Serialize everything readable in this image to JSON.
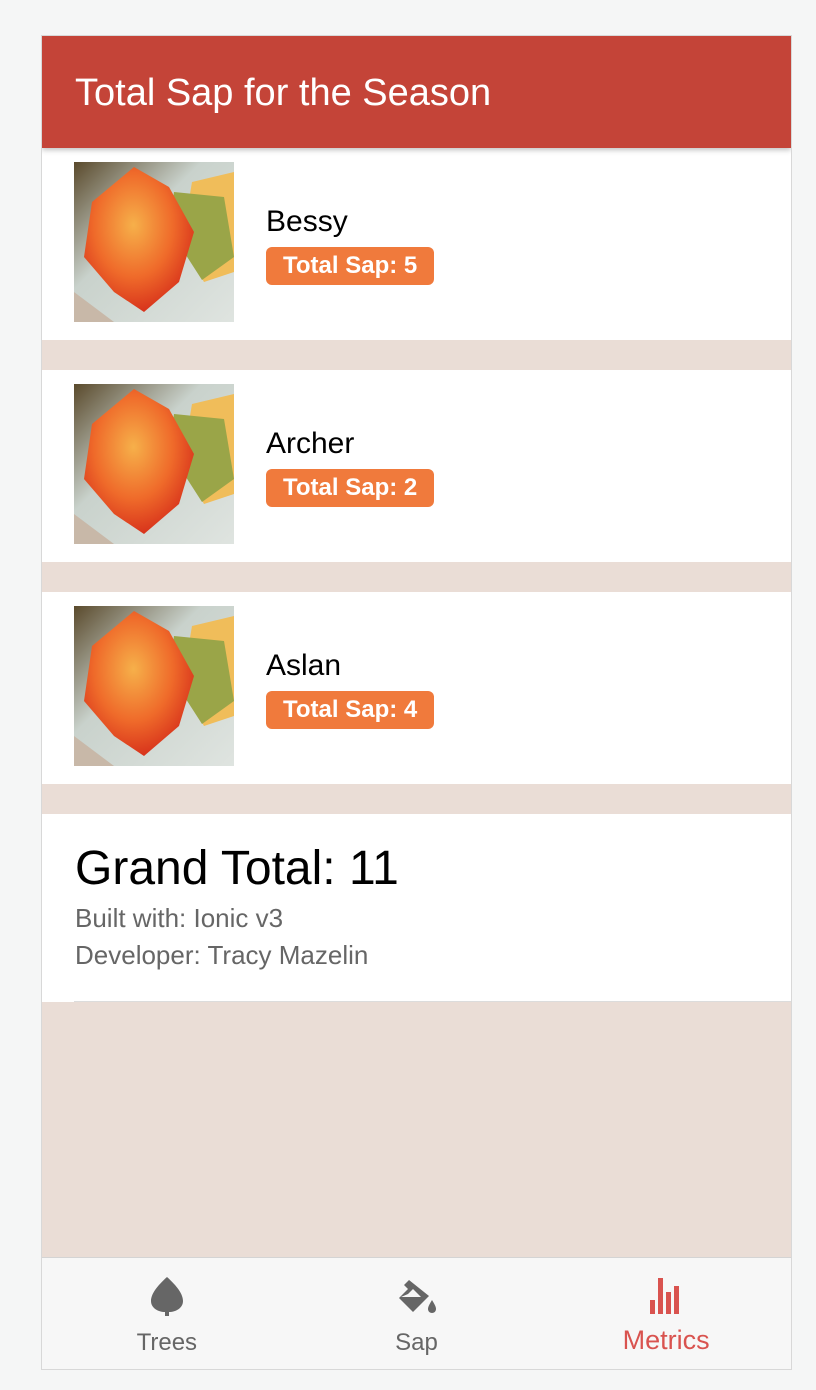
{
  "header": {
    "title": "Total Sap for the Season"
  },
  "trees": [
    {
      "name": "Bessy",
      "badge": "Total Sap: 5",
      "image": "maple-leaf-photo"
    },
    {
      "name": "Archer",
      "badge": "Total Sap: 2",
      "image": "maple-leaf-photo"
    },
    {
      "name": "Aslan",
      "badge": "Total Sap: 4",
      "image": "maple-leaf-photo"
    }
  ],
  "summary": {
    "grand_total": "Grand Total: 11",
    "built_with": "Built with: Ionic v3",
    "developer": "Developer: Tracy Mazelin"
  },
  "tabs": [
    {
      "label": "Trees",
      "icon": "leaf-icon",
      "active": false
    },
    {
      "label": "Sap",
      "icon": "paint-bucket-icon",
      "active": false
    },
    {
      "label": "Metrics",
      "icon": "bar-chart-icon",
      "active": true
    }
  ],
  "colors": {
    "header": "#c44438",
    "badge": "#f07a3c",
    "background": "#eaddd6",
    "active_tab": "#d9534f",
    "inactive_tab": "#666666"
  }
}
